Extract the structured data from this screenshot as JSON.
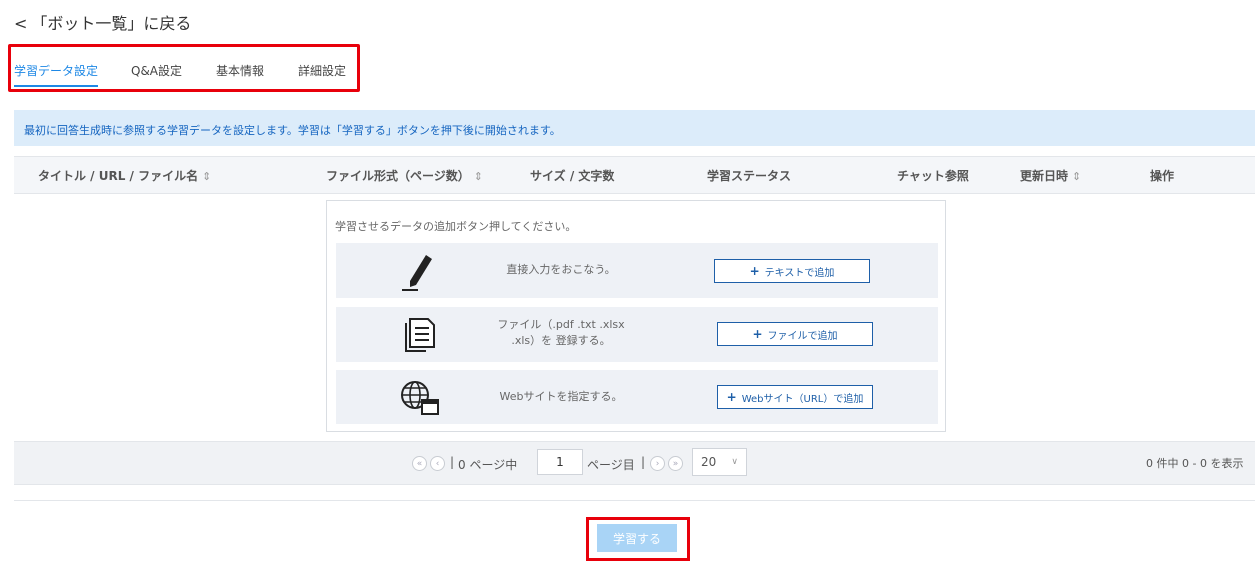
{
  "header": {
    "back_chevron": "<",
    "back_label": "「ボット一覧」に戻る"
  },
  "tabs": [
    {
      "label": "学習データ設定",
      "active": true
    },
    {
      "label": "Q&A設定",
      "active": false
    },
    {
      "label": "基本情報",
      "active": false
    },
    {
      "label": "詳細設定",
      "active": false
    }
  ],
  "info_banner": "最初に回答生成時に参照する学習データを設定します。学習は「学習する」ボタンを押下後に開始されます。",
  "table": {
    "columns": [
      {
        "label": "タイトル / URL / ファイル名",
        "sortable": true
      },
      {
        "label": "ファイル形式（ページ数）",
        "sortable": true
      },
      {
        "label": "サイズ / 文字数",
        "sortable": false
      },
      {
        "label": "学習ステータス",
        "sortable": false
      },
      {
        "label": "チャット参照",
        "sortable": false
      },
      {
        "label": "更新日時",
        "sortable": true
      },
      {
        "label": "操作",
        "sortable": false
      }
    ],
    "sort_icon": "⇕"
  },
  "empty_state": {
    "message": "学習させるデータの追加ボタン押してください。",
    "rows": [
      {
        "icon": "pen-icon",
        "desc": "直接入力をおこなう。",
        "button": "テキストで追加"
      },
      {
        "icon": "documents-icon",
        "desc_line1": "ファイル（.pdf .txt .xlsx",
        "desc_line2": ".xls）を 登録する。",
        "button": "ファイルで追加"
      },
      {
        "icon": "globe-window-icon",
        "desc": "Webサイトを指定する。",
        "button": "Webサイト（URL）で追加"
      }
    ],
    "plus": "+"
  },
  "pager": {
    "first": "«",
    "prev": "‹",
    "next": "›",
    "last": "»",
    "sep": "|",
    "page_prefix": "0 ページ中",
    "current_page": "1",
    "page_suffix": "ページ目",
    "per_page": "20",
    "per_page_chevron": "∨",
    "summary": "0 件中 0 - 0 を表示"
  },
  "learn_button": "学習する",
  "colors": {
    "accent": "#1e88e5",
    "highlight": "#e8000b",
    "banner_bg": "#dcecfa",
    "learn_btn": "#a9d4f6"
  }
}
